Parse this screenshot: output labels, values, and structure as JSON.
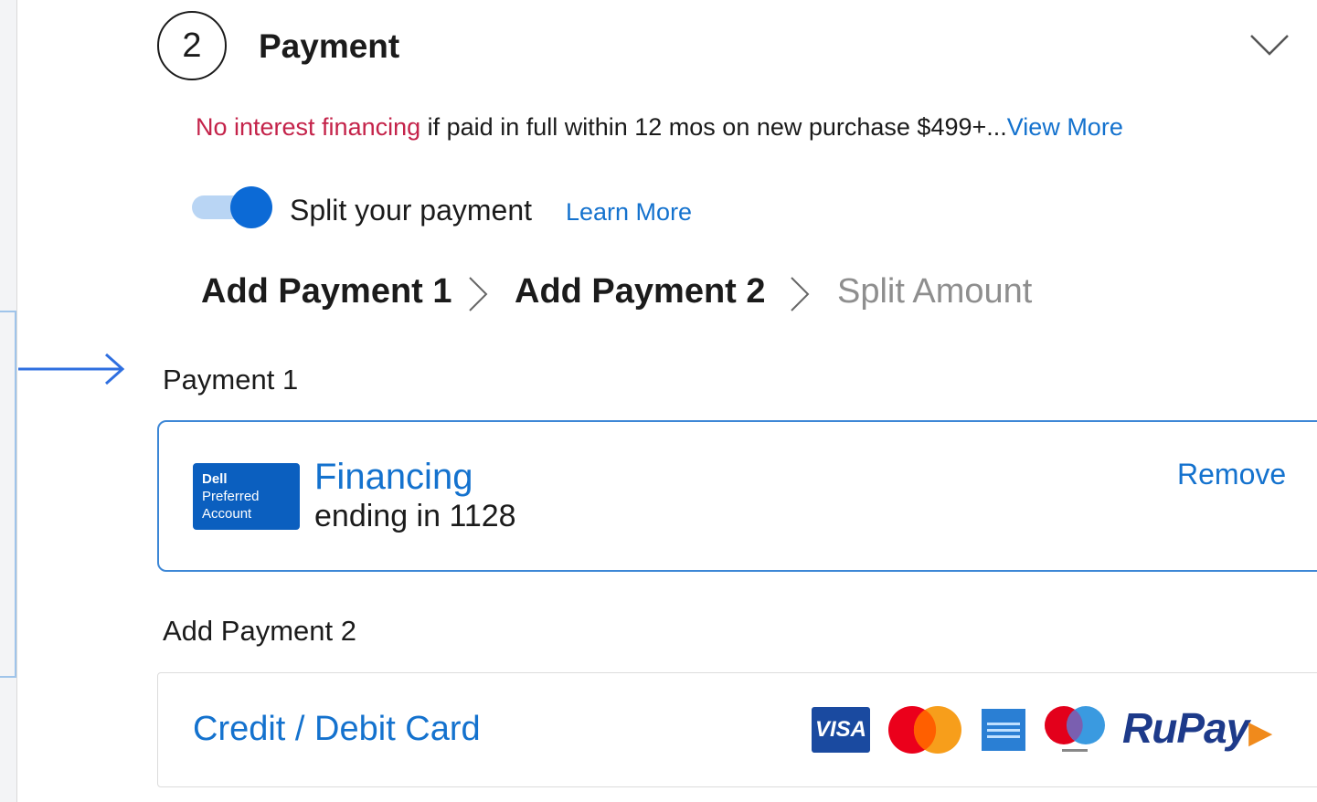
{
  "step": {
    "number": "2",
    "title": "Payment"
  },
  "promo": {
    "highlight": "No interest financing",
    "text": " if paid in full within 12 mos on new purchase $499+...",
    "link": "View More"
  },
  "split": {
    "enabled": true,
    "label": "Split your payment",
    "learn_more": "Learn More"
  },
  "breadcrumb": {
    "steps": [
      "Add Payment 1",
      "Add Payment 2",
      "Split Amount"
    ]
  },
  "payment1": {
    "section_label": "Payment 1",
    "logo_lines": [
      "Dell",
      "Preferred",
      "Account"
    ],
    "method": "Financing",
    "detail": "ending in 1128",
    "remove": "Remove"
  },
  "payment2": {
    "section_label": "Add Payment 2",
    "option": "Credit / Debit Card",
    "card_logos": [
      "visa-logo",
      "mastercard-logo",
      "amex-logo",
      "maestro-logo",
      "rupay-logo"
    ],
    "visa_text": "VISA",
    "rupay_text": "RuPay"
  },
  "colors": {
    "accent": "#1472ce",
    "promo_red": "#c4234a",
    "toggle_on": "#0c6ad6",
    "card_border": "#3d87d6"
  }
}
